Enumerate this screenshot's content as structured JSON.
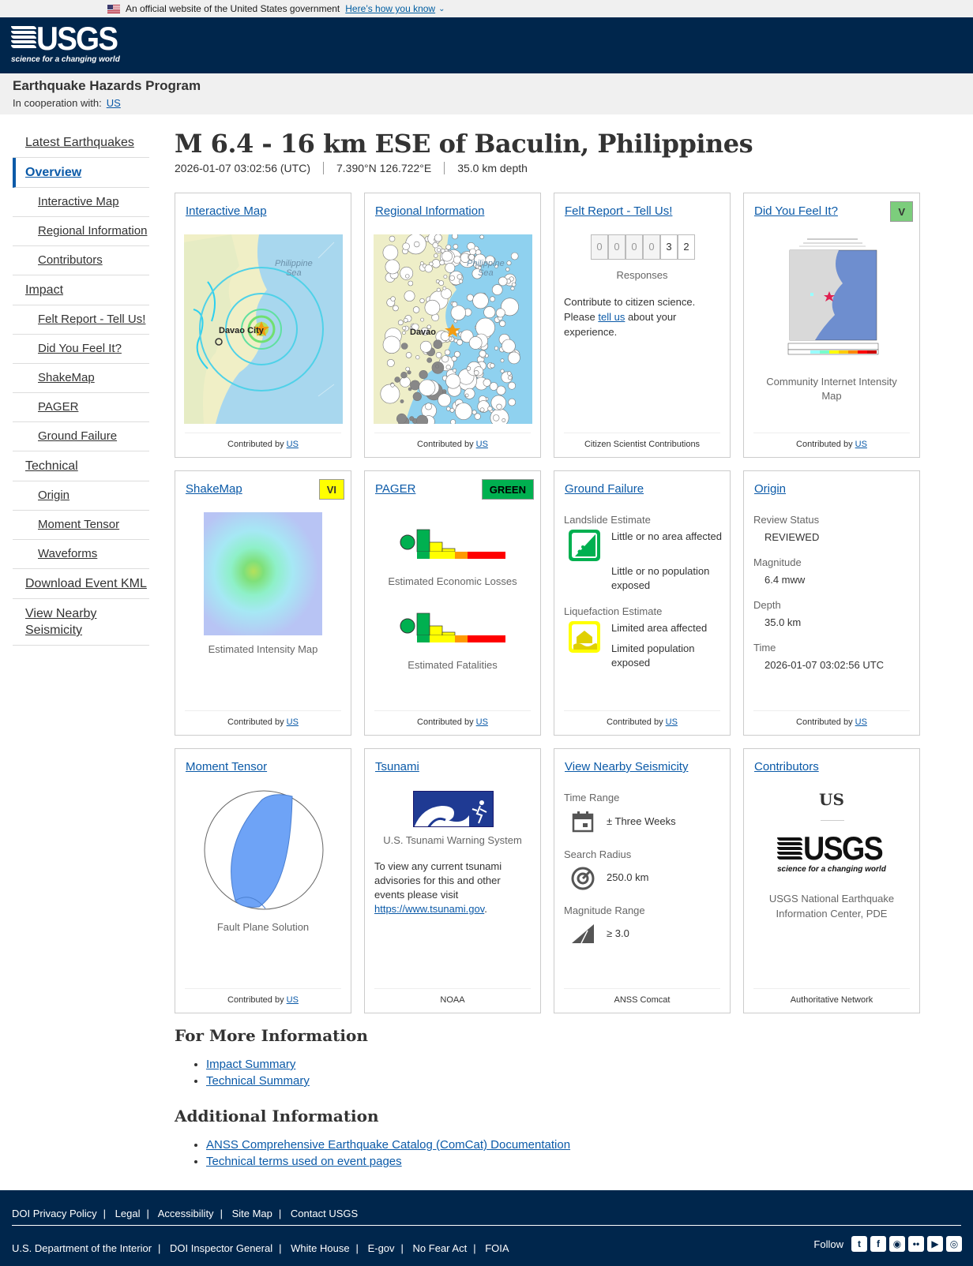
{
  "banner": {
    "official": "An official website of the United States government",
    "how": "Here’s how you know"
  },
  "header": {
    "logo_word": "USGS",
    "logo_tag": "science for a changing world"
  },
  "subhead": {
    "program": "Earthquake Hazards Program",
    "coop_label": "In cooperation with:",
    "coop_link": "US"
  },
  "sidebar": {
    "items": [
      {
        "label": "Latest Earthquakes"
      },
      {
        "label": "Overview"
      },
      {
        "label": "Interactive Map"
      },
      {
        "label": "Regional Information"
      },
      {
        "label": "Contributors"
      },
      {
        "label": "Impact"
      },
      {
        "label": "Felt Report - Tell Us!"
      },
      {
        "label": "Did You Feel It?"
      },
      {
        "label": "ShakeMap"
      },
      {
        "label": "PAGER"
      },
      {
        "label": "Ground Failure"
      },
      {
        "label": "Technical"
      },
      {
        "label": "Origin"
      },
      {
        "label": "Moment Tensor"
      },
      {
        "label": "Waveforms"
      },
      {
        "label": "Download Event KML"
      },
      {
        "label": "View Nearby Seismicity"
      }
    ]
  },
  "event": {
    "title": "M 6.4 - 16 km ESE of Baculin, Philippines",
    "time": "2026-01-07 03:02:56 (UTC)",
    "coords": "7.390°N 126.722°E",
    "depth": "35.0 km depth"
  },
  "common": {
    "contributed_by": "Contributed by",
    "us": "US"
  },
  "cards": {
    "interactive_map": {
      "title": "Interactive Map",
      "sea": "Philippine\nSea",
      "city": "Davao City"
    },
    "regional": {
      "title": "Regional Information",
      "sea": "Philippine\nSea",
      "city": "Davao"
    },
    "felt": {
      "title": "Felt Report - Tell Us!",
      "digits": [
        "0",
        "0",
        "0",
        "0",
        "3",
        "2"
      ],
      "responses": "Responses",
      "text1": "Contribute to citizen science. Please ",
      "link": "tell us",
      "text2": " about your experience.",
      "footer": "Citizen Scientist Contributions"
    },
    "dyfi": {
      "title": "Did You Feel It?",
      "badge": "V",
      "caption": "Community Internet Intensity Map"
    },
    "shakemap": {
      "title": "ShakeMap",
      "badge": "VI",
      "caption": "Estimated Intensity Map"
    },
    "pager": {
      "title": "PAGER",
      "badge": "GREEN",
      "losses": "Estimated Economic Losses",
      "fatalities": "Estimated Fatalities"
    },
    "ground": {
      "title": "Ground Failure",
      "landslide": "Landslide Estimate",
      "ls1": "Little or no area affected",
      "ls2": "Little or no population exposed",
      "liquefaction": "Liquefaction Estimate",
      "lq1": "Limited area affected",
      "lq2": "Limited population exposed"
    },
    "origin": {
      "title": "Origin",
      "review_label": "Review Status",
      "review": "REVIEWED",
      "mag_label": "Magnitude",
      "mag": "6.4 mww",
      "depth_label": "Depth",
      "depth": "35.0 km",
      "time_label": "Time",
      "time": "2026-01-07 03:02:56 UTC"
    },
    "moment": {
      "title": "Moment Tensor",
      "caption": "Fault Plane Solution"
    },
    "tsunami": {
      "title": "Tsunami",
      "org": "U.S. Tsunami Warning System",
      "text": "To view any current tsunami advisories for this and other events please visit ",
      "link": "https://www.tsunami.gov",
      "footer": "NOAA"
    },
    "nearby": {
      "title": "View Nearby Seismicity",
      "tr_label": "Time Range",
      "tr": "± Three Weeks",
      "sr_label": "Search Radius",
      "sr": "250.0 km",
      "mr_label": "Magnitude Range",
      "mr": "≥ 3.0",
      "footer": "ANSS Comcat"
    },
    "contributors": {
      "title": "Contributors",
      "code": "US",
      "name": "USGS National Earthquake Information Center, PDE",
      "footer": "Authoritative Network"
    }
  },
  "more": {
    "title": "For More Information",
    "links": [
      "Impact Summary",
      "Technical Summary"
    ]
  },
  "additional": {
    "title": "Additional Information",
    "links": [
      "ANSS Comprehensive Earthquake Catalog (ComCat) Documentation",
      "Technical terms used on event pages"
    ]
  },
  "footer": {
    "row1": [
      "DOI Privacy Policy",
      "Legal",
      "Accessibility",
      "Site Map",
      "Contact USGS"
    ],
    "row2": [
      "U.S. Department of the Interior",
      "DOI Inspector General",
      "White House",
      "E-gov",
      "No Fear Act",
      "FOIA"
    ],
    "follow": "Follow"
  }
}
